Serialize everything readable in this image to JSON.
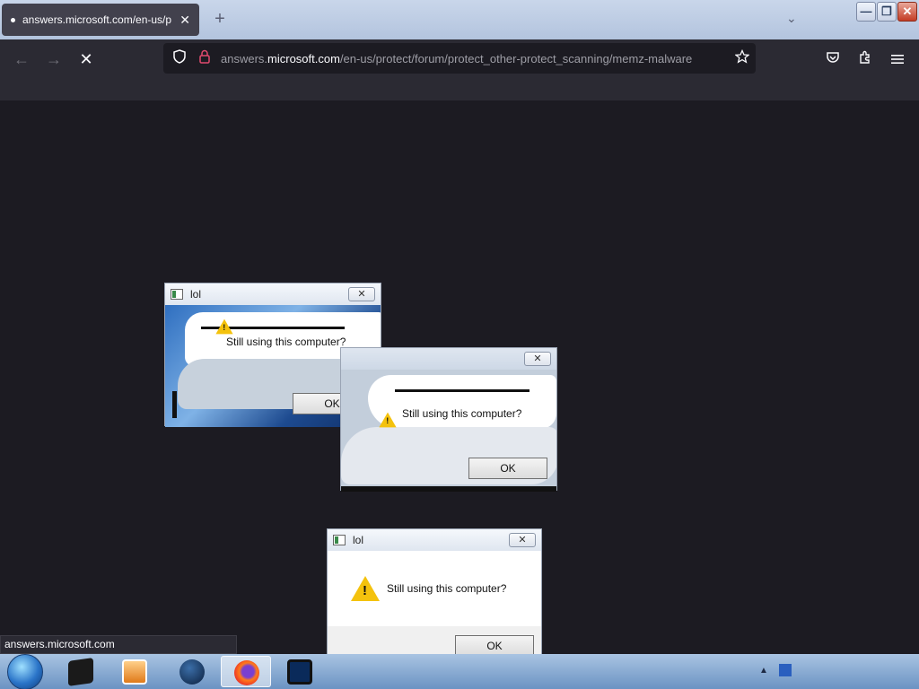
{
  "browser": {
    "tab": {
      "title": "answers.microsoft.com/en-us/p",
      "close": "✕"
    },
    "new_tab": "+",
    "list_all_tabs": "⌄",
    "window_buttons": {
      "minimize": "—",
      "restore": "❐",
      "close": "✕"
    },
    "nav": {
      "back": "←",
      "forward": "→",
      "stop": "✕"
    },
    "url": {
      "prefix": "answers.",
      "host": "microsoft.com",
      "path": "/en-us/protect/forum/protect_other-protect_scanning/memz-malware"
    },
    "toolbar_icons": [
      "shield-icon",
      "lock-icon",
      "bookmark-star-icon",
      "pocket-icon",
      "extensions-icon",
      "menu-icon"
    ]
  },
  "dialogs": [
    {
      "title": "lol",
      "message": "Still using this computer?",
      "ok": "OK"
    },
    {
      "title": "",
      "message": "Still using this computer?",
      "ok": "OK"
    },
    {
      "title": "lol",
      "message": "Still using this computer?",
      "ok": "OK"
    }
  ],
  "status_bar": {
    "text": "answers.microsoft.com"
  },
  "taskbar": {
    "items": [
      "start-orb-icon",
      "terminal-icon",
      "media-player-icon",
      "globe-icon",
      "firefox-icon",
      "tablet-app-icon"
    ],
    "tray": {
      "arrow": "▲"
    }
  },
  "colors": {
    "page_background": "#1c1b22",
    "toolbar": "#2b2a33",
    "warning": "#f4c20d",
    "url_lock": "#e24b6e"
  }
}
